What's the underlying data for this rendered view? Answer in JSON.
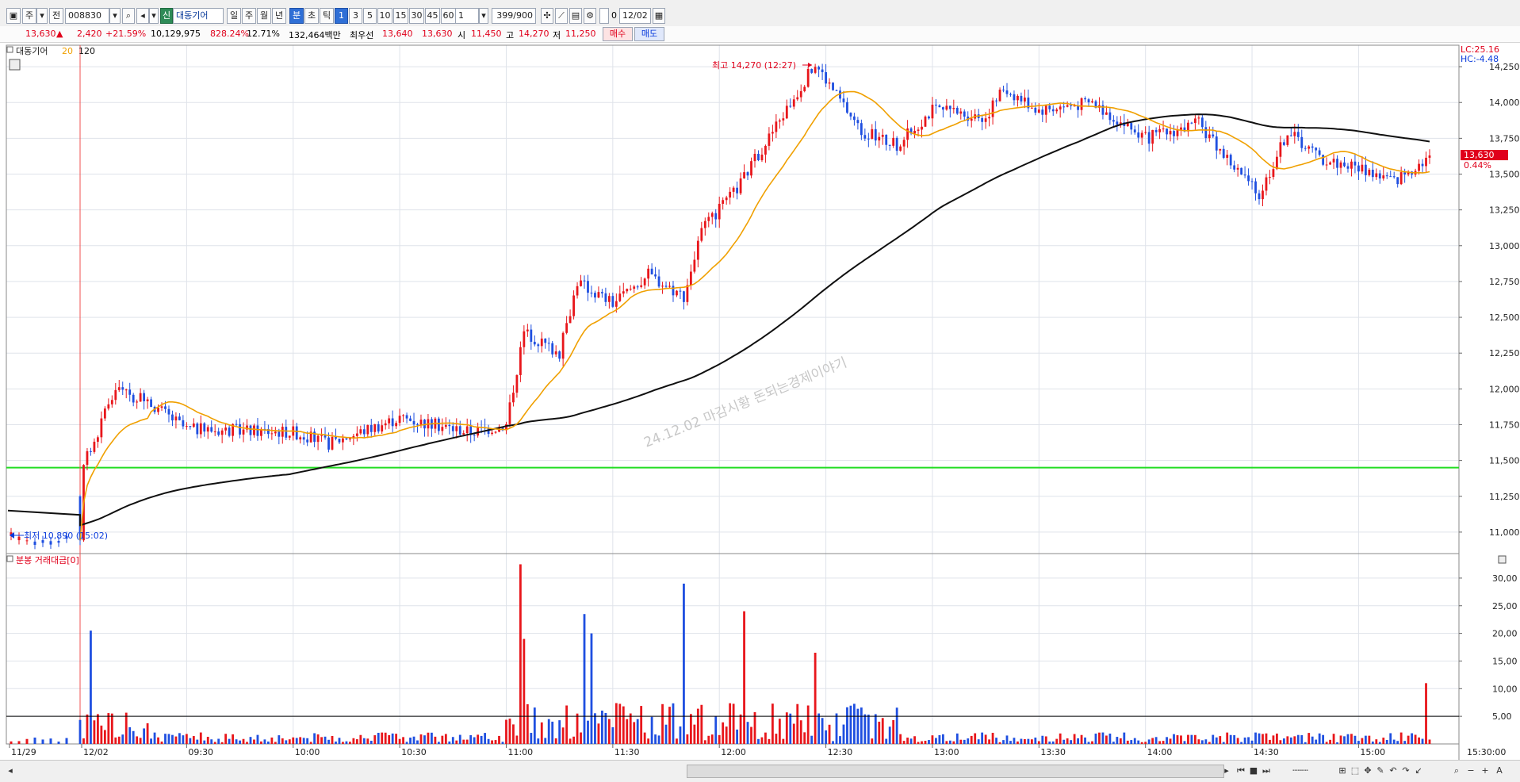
{
  "toolbar": {
    "stock_code": "008830",
    "stock_name": "대동기어",
    "name_tag": "신",
    "market_btn": "주",
    "prev_btn": "전",
    "period_buttons": [
      "일",
      "주",
      "월",
      "년",
      "분",
      "초",
      "틱"
    ],
    "active_period": "분",
    "interval_buttons": [
      "1",
      "3",
      "5",
      "10",
      "15",
      "30",
      "45",
      "60"
    ],
    "active_interval": "1",
    "interval_select": "1",
    "count_value": "399",
    "count_total": "/900",
    "checkbox_label": "0",
    "date_value": "12/02"
  },
  "quote": {
    "price": "13,630",
    "change_arrow": "▲",
    "change": "2,420",
    "change_pct": "+21.59%",
    "volume": "10,129,975",
    "volume_ratio": "828.24%",
    "turnover": "12.71%",
    "amount": "132,464백만",
    "best_label": "최우선",
    "best_ask": "13,640",
    "best_bid": "13,630",
    "open_label": "시",
    "open": "11,450",
    "high_label": "고",
    "high": "14,270",
    "low_label": "저",
    "low": "11,250",
    "buy_label": "매수",
    "sell_label": "매도"
  },
  "legend": {
    "name": "대동기어",
    "ma_short": "20",
    "ma_long": "120"
  },
  "volume_legend": "분봉 거래대금[0]",
  "lc_label": "LC:25.16",
  "hc_label": "HC:-4.48",
  "current_price_tag": "13,630",
  "current_pct_tag": "0.44%",
  "high_annotation": "최고 14,270 (12:27)",
  "low_annotation": "최저 10,890 (15:02)",
  "watermark": "24.12.02 마감시황 돈되는경제이야기",
  "time_axis_end": "15:30:00",
  "colors": {
    "up": "#e8161b",
    "down": "#1f4fe0",
    "ma20": "#f0a000",
    "ma120": "#101010",
    "ref_line": "#22dd22",
    "grid": "#dfe3ea"
  },
  "chart_data": {
    "type": "candlestick",
    "price_axis": {
      "ticks": [
        "14,250",
        "14,000",
        "13,750",
        "13,500",
        "13,250",
        "13,000",
        "12,750",
        "12,500",
        "12,250",
        "12,000",
        "11,750",
        "11,500",
        "11,250",
        "11,000"
      ],
      "range": [
        10850,
        14400
      ]
    },
    "volume_axis": {
      "ticks": [
        "30,00",
        "25,00",
        "20,00",
        "15,00",
        "10,00",
        "5,00"
      ],
      "range": [
        0,
        33
      ],
      "ref_level": 5
    },
    "time_axis": [
      "11/29",
      "12/02",
      "09:30",
      "10:00",
      "10:30",
      "11:00",
      "11:30",
      "12:00",
      "12:30",
      "13:00",
      "13:30",
      "14:00",
      "14:30",
      "15:00"
    ],
    "reference_price": 11450,
    "high": 14270,
    "low": 10890,
    "last": 13630,
    "price_keypoints": [
      {
        "t": "11/29 15:02",
        "p": 10950
      },
      {
        "t": "09:00",
        "p": 11400
      },
      {
        "t": "09:10",
        "p": 12000
      },
      {
        "t": "09:20",
        "p": 11900
      },
      {
        "t": "09:30",
        "p": 11720
      },
      {
        "t": "10:00",
        "p": 11700
      },
      {
        "t": "10:10",
        "p": 11620
      },
      {
        "t": "10:30",
        "p": 11800
      },
      {
        "t": "10:50",
        "p": 11700
      },
      {
        "t": "11:00",
        "p": 11750
      },
      {
        "t": "11:05",
        "p": 12400
      },
      {
        "t": "11:15",
        "p": 12250
      },
      {
        "t": "11:20",
        "p": 12750
      },
      {
        "t": "11:30",
        "p": 12600
      },
      {
        "t": "11:40",
        "p": 12800
      },
      {
        "t": "11:50",
        "p": 12650
      },
      {
        "t": "11:55",
        "p": 13100
      },
      {
        "t": "12:05",
        "p": 13400
      },
      {
        "t": "12:15",
        "p": 13800
      },
      {
        "t": "12:27",
        "p": 14270
      },
      {
        "t": "12:40",
        "p": 13800
      },
      {
        "t": "12:50",
        "p": 13700
      },
      {
        "t": "13:00",
        "p": 13950
      },
      {
        "t": "13:15",
        "p": 13900
      },
      {
        "t": "13:20",
        "p": 14100
      },
      {
        "t": "13:30",
        "p": 13950
      },
      {
        "t": "13:45",
        "p": 14000
      },
      {
        "t": "14:00",
        "p": 13750
      },
      {
        "t": "14:15",
        "p": 13850
      },
      {
        "t": "14:25",
        "p": 13550
      },
      {
        "t": "14:32",
        "p": 13350
      },
      {
        "t": "14:40",
        "p": 13800
      },
      {
        "t": "14:50",
        "p": 13600
      },
      {
        "t": "15:00",
        "p": 13550
      },
      {
        "t": "15:10",
        "p": 13450
      },
      {
        "t": "15:20",
        "p": 13630
      }
    ],
    "volume_spikes": [
      {
        "t": "09:03",
        "v": 20.5
      },
      {
        "t": "11:04",
        "v": 32.5
      },
      {
        "t": "11:05",
        "v": 19
      },
      {
        "t": "11:22",
        "v": 23.5
      },
      {
        "t": "11:24",
        "v": 20
      },
      {
        "t": "11:50",
        "v": 29
      },
      {
        "t": "12:07",
        "v": 24
      },
      {
        "t": "12:27",
        "v": 16.5
      },
      {
        "t": "15:19",
        "v": 11
      }
    ]
  }
}
